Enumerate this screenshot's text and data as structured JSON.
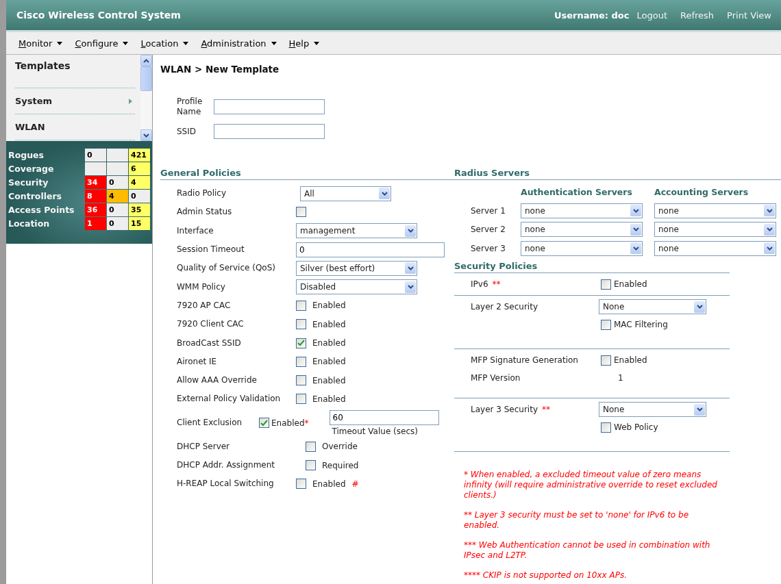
{
  "header": {
    "title": "Cisco Wireless Control System",
    "user": "Username: doc",
    "links": [
      "Logout",
      "Refresh",
      "Print View"
    ]
  },
  "menu": [
    "Monitor",
    "Configure",
    "Location",
    "Administration",
    "Help"
  ],
  "sidebar": {
    "title": "Templates",
    "items": [
      {
        "label": "System",
        "has_submenu": true
      },
      {
        "label": "WLAN",
        "has_submenu": false
      }
    ]
  },
  "alarm_summary": [
    {
      "label": "Rogues",
      "cells": [
        {
          "text": "0",
          "color": "#eeeeee"
        },
        {
          "color": "#eeeeee"
        },
        {
          "text": "421",
          "color": "#ffff66"
        }
      ]
    },
    {
      "label": "Coverage",
      "cells": [
        {
          "color": "#eeeeee"
        },
        {
          "color": "#eeeeee"
        },
        {
          "text": "6",
          "color": "#ffff66"
        }
      ]
    },
    {
      "label": "Security",
      "cells": [
        {
          "text": "34",
          "color": "#ff0000"
        },
        {
          "text": "0",
          "color": "#eeeeee"
        },
        {
          "text": "4",
          "color": "#ffff66"
        }
      ]
    },
    {
      "label": "Controllers",
      "cells": [
        {
          "text": "8",
          "color": "#ff0000"
        },
        {
          "text": "4",
          "color": "#ffbb00"
        },
        {
          "text": "0",
          "color": "#eeeeee"
        }
      ]
    },
    {
      "label": "Access Points",
      "cells": [
        {
          "text": "36",
          "color": "#ff0000"
        },
        {
          "text": "0",
          "color": "#eeeeee"
        },
        {
          "text": "35",
          "color": "#ffff66"
        }
      ]
    },
    {
      "label": "Location",
      "cells": [
        {
          "text": "1",
          "color": "#ff0000"
        },
        {
          "text": "0",
          "color": "#eeeeee"
        },
        {
          "text": "15",
          "color": "#ffff66"
        }
      ]
    }
  ],
  "page_title": "WLAN > New Template",
  "profile_fields": [
    {
      "label": "Profile Name"
    },
    {
      "label": "SSID"
    }
  ],
  "general_policies": {
    "title": "General Policies",
    "rows": [
      {
        "label": "Radio Policy",
        "kind": "select",
        "value": "All"
      },
      {
        "label": "Admin Status",
        "kind": "checkbox",
        "checked": false
      },
      {
        "label": "Interface",
        "kind": "select",
        "value": "management"
      },
      {
        "label": "Session Timeout",
        "kind": "text",
        "value": "0"
      },
      {
        "label": "Quality of Service (QoS)",
        "kind": "select",
        "value": "Silver (best effort)"
      },
      {
        "label": "WMM Policy",
        "kind": "select",
        "value": "Disabled"
      },
      {
        "label": "7920 AP CAC",
        "kind": "checkbox",
        "checked": false,
        "option": "Enabled"
      },
      {
        "label": "7920 Client CAC",
        "kind": "checkbox",
        "checked": false,
        "option": "Enabled"
      },
      {
        "label": "BroadCast SSID",
        "kind": "checkbox",
        "checked": true,
        "option": "Enabled"
      },
      {
        "label": "Aironet IE",
        "kind": "checkbox",
        "checked": false,
        "option": "Enabled"
      },
      {
        "label": "Allow AAA Override",
        "kind": "checkbox",
        "checked": false,
        "option": "Enabled"
      },
      {
        "label": "External Policy Validation",
        "kind": "checkbox",
        "checked": false,
        "option": "Enabled"
      },
      {
        "label": "Client Exclusion",
        "kind": "exclusion",
        "checked": true,
        "option": "Enabled",
        "mark": "*",
        "value": "60",
        "hint": "Timeout Value (secs)"
      },
      {
        "label": "DHCP Server",
        "kind": "checkbox",
        "checked": false,
        "option": "Override"
      },
      {
        "label": "DHCP Addr. Assignment",
        "kind": "checkbox",
        "checked": false,
        "option": "Required"
      },
      {
        "label": "H-REAP Local Switching",
        "kind": "checkbox",
        "checked": false,
        "option": "Enabled",
        "mark": "#"
      }
    ]
  },
  "radius_servers": {
    "title": "Radius Servers",
    "columns": [
      "Authentication Servers",
      "Accounting Servers"
    ],
    "rows": [
      {
        "label": "Server 1",
        "values": [
          "none",
          "none"
        ]
      },
      {
        "label": "Server 2",
        "values": [
          "none",
          "none"
        ]
      },
      {
        "label": "Server 3",
        "values": [
          "none",
          "none"
        ]
      }
    ]
  },
  "security_policies": {
    "title": "Security Policies",
    "groups": [
      {
        "rows": [
          {
            "label": "IPv6",
            "mark": "**",
            "kind": "checkbox",
            "checked": false,
            "option": "Enabled"
          }
        ]
      },
      {
        "rows": [
          {
            "label": "Layer 2 Security",
            "kind": "select",
            "value": "None"
          },
          {
            "kind": "checkbox",
            "checked": false,
            "option": "MAC Filtering"
          }
        ]
      },
      {
        "rows": [
          {
            "label": "MFP Signature Generation",
            "kind": "checkbox",
            "checked": false,
            "option": "Enabled"
          },
          {
            "label": "MFP Version",
            "kind": "value",
            "value": "1"
          }
        ]
      },
      {
        "rows": [
          {
            "label": "Layer 3 Security",
            "mark": "**",
            "kind": "select",
            "value": "None"
          },
          {
            "kind": "checkbox",
            "checked": false,
            "option": "Web Policy"
          }
        ]
      }
    ]
  },
  "notes": [
    "* When enabled, a excluded timeout value of zero means infinity (will require administrative override to reset excluded clients.)",
    "** Layer 3 security must be set to 'none' for IPv6 to be enabled.",
    "*** Web Authentication cannot be used in combination with IPsec and L2TP.",
    "**** CKIP is not supported on 10xx APs."
  ]
}
